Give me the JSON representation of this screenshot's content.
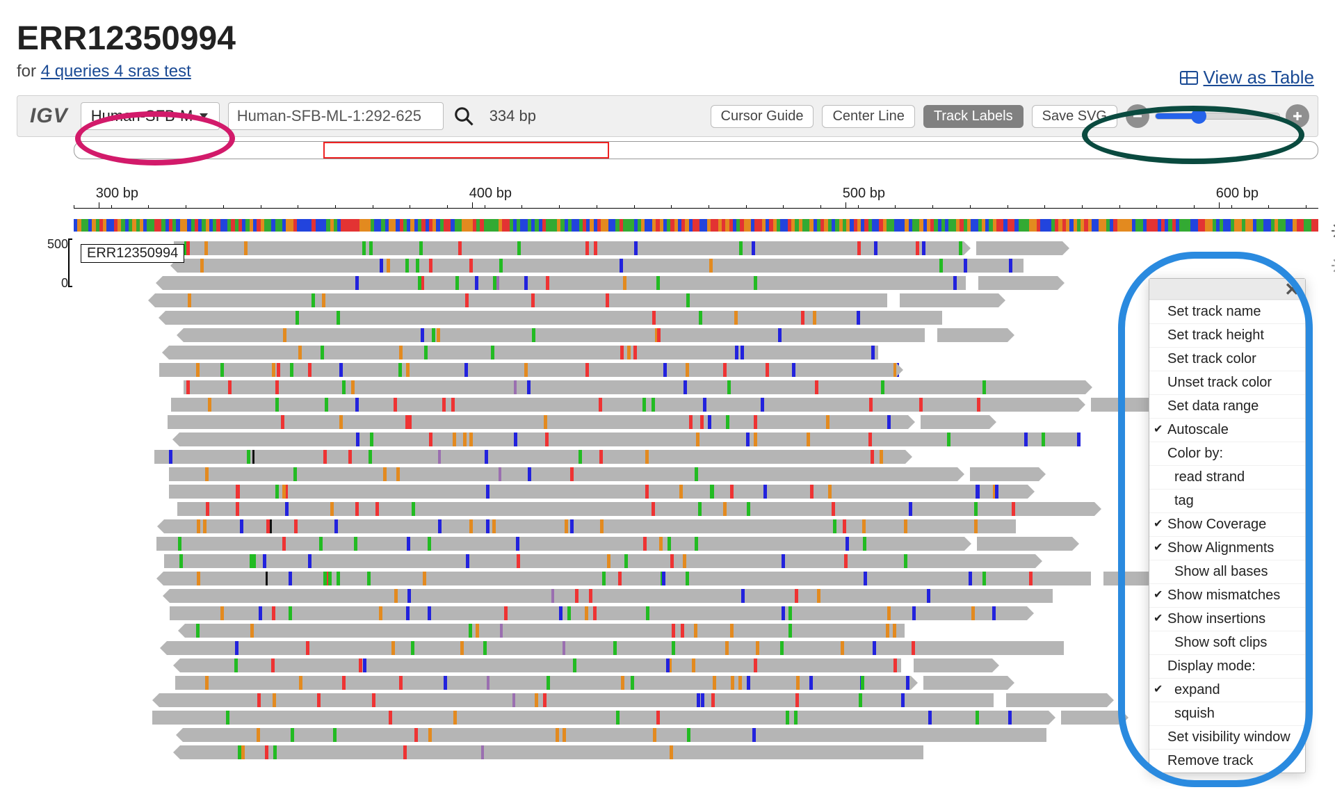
{
  "page": {
    "title": "ERR12350994",
    "subtitle_prefix": "for ",
    "subtitle_link": "4 queries 4 sras test",
    "view_as_table": "View as Table"
  },
  "toolbar": {
    "logo": "IGV",
    "ref_select": "Human-SFB-M",
    "locus": "Human-SFB-ML-1:292-625",
    "span_bp": "334 bp",
    "buttons": {
      "cursor_guide": "Cursor Guide",
      "center_line": "Center Line",
      "track_labels": "Track Labels",
      "save_svg": "Save SVG"
    },
    "zoom": {
      "slider_percent": 35
    }
  },
  "ruler": {
    "ticks": [
      {
        "pos_pct": 2,
        "label": "300 bp"
      },
      {
        "pos_pct": 32,
        "label": "400 bp"
      },
      {
        "pos_pct": 62,
        "label": "500 bp"
      },
      {
        "pos_pct": 92,
        "label": "600 bp"
      }
    ]
  },
  "track": {
    "label": "ERR12350994",
    "scale_max": "500",
    "scale_min": "0"
  },
  "context_menu": {
    "items": [
      {
        "label": "Set track name",
        "checked": false
      },
      {
        "label": "Set track height",
        "checked": false
      },
      {
        "label": "Set track color",
        "checked": false
      },
      {
        "label": "Unset track color",
        "checked": false
      },
      {
        "label": "Set data range",
        "checked": false
      },
      {
        "label": "Autoscale",
        "checked": true
      },
      {
        "label": "Color by:",
        "checked": false,
        "heading": true
      },
      {
        "label": "read strand",
        "checked": false,
        "sub": true
      },
      {
        "label": "tag",
        "checked": false,
        "sub": true
      },
      {
        "label": "Show Coverage",
        "checked": true
      },
      {
        "label": "Show Alignments",
        "checked": true
      },
      {
        "label": "Show all bases",
        "checked": false,
        "sub": true
      },
      {
        "label": "Show mismatches",
        "checked": true
      },
      {
        "label": "Show insertions",
        "checked": true
      },
      {
        "label": "Show soft clips",
        "checked": false,
        "sub": true
      },
      {
        "label": "Display mode:",
        "checked": false,
        "heading": true
      },
      {
        "label": "expand",
        "checked": true,
        "sub": true
      },
      {
        "label": "squish",
        "checked": false,
        "sub": true
      },
      {
        "label": "Set visibility window",
        "checked": false
      },
      {
        "label": "Remove track",
        "checked": false
      }
    ]
  },
  "colors": {
    "A": "#33aa33",
    "C": "#2244dd",
    "G": "#e38a1f",
    "T": "#e33333",
    "N": "#888888"
  }
}
